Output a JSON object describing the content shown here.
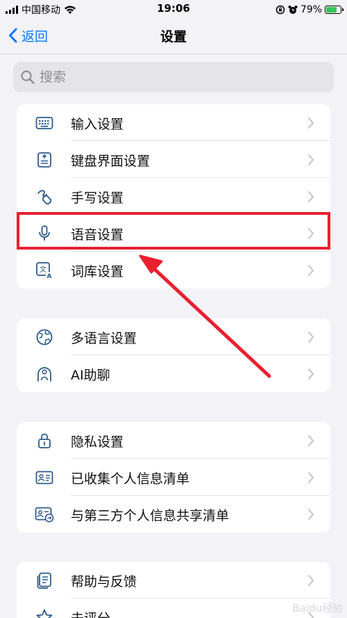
{
  "status_bar": {
    "carrier": "中国移动",
    "time": "19:06",
    "battery": "79%",
    "battery_level": 0.79
  },
  "nav": {
    "back_label": "返回",
    "title": "设置"
  },
  "search": {
    "placeholder": "搜索"
  },
  "groups": [
    {
      "items": [
        {
          "label": "输入设置",
          "icon": "keyboard-icon"
        },
        {
          "label": "键盘界面设置",
          "icon": "keyboard-layout-icon"
        },
        {
          "label": "手写设置",
          "icon": "handwriting-icon"
        },
        {
          "label": "语音设置",
          "icon": "microphone-icon"
        },
        {
          "label": "词库设置",
          "icon": "dictionary-icon"
        }
      ]
    },
    {
      "items": [
        {
          "label": "多语言设置",
          "icon": "globe-icon"
        },
        {
          "label": "AI助聊",
          "icon": "ai-chat-icon"
        }
      ]
    },
    {
      "items": [
        {
          "label": "隐私设置",
          "icon": "lock-icon"
        },
        {
          "label": "已收集个人信息清单",
          "icon": "id-card-icon"
        },
        {
          "label": "与第三方个人信息共享清单",
          "icon": "share-card-icon"
        }
      ]
    },
    {
      "items": [
        {
          "label": "帮助与反馈",
          "icon": "help-icon"
        },
        {
          "label": "去评分",
          "icon": "star-icon"
        }
      ]
    }
  ],
  "annotation": {
    "highlight_color": "#e8202f",
    "highlighted_item": "语音设置"
  },
  "watermark": "Baidu经验",
  "colors": {
    "accent": "#007aff",
    "background": "#f2f2f7"
  }
}
